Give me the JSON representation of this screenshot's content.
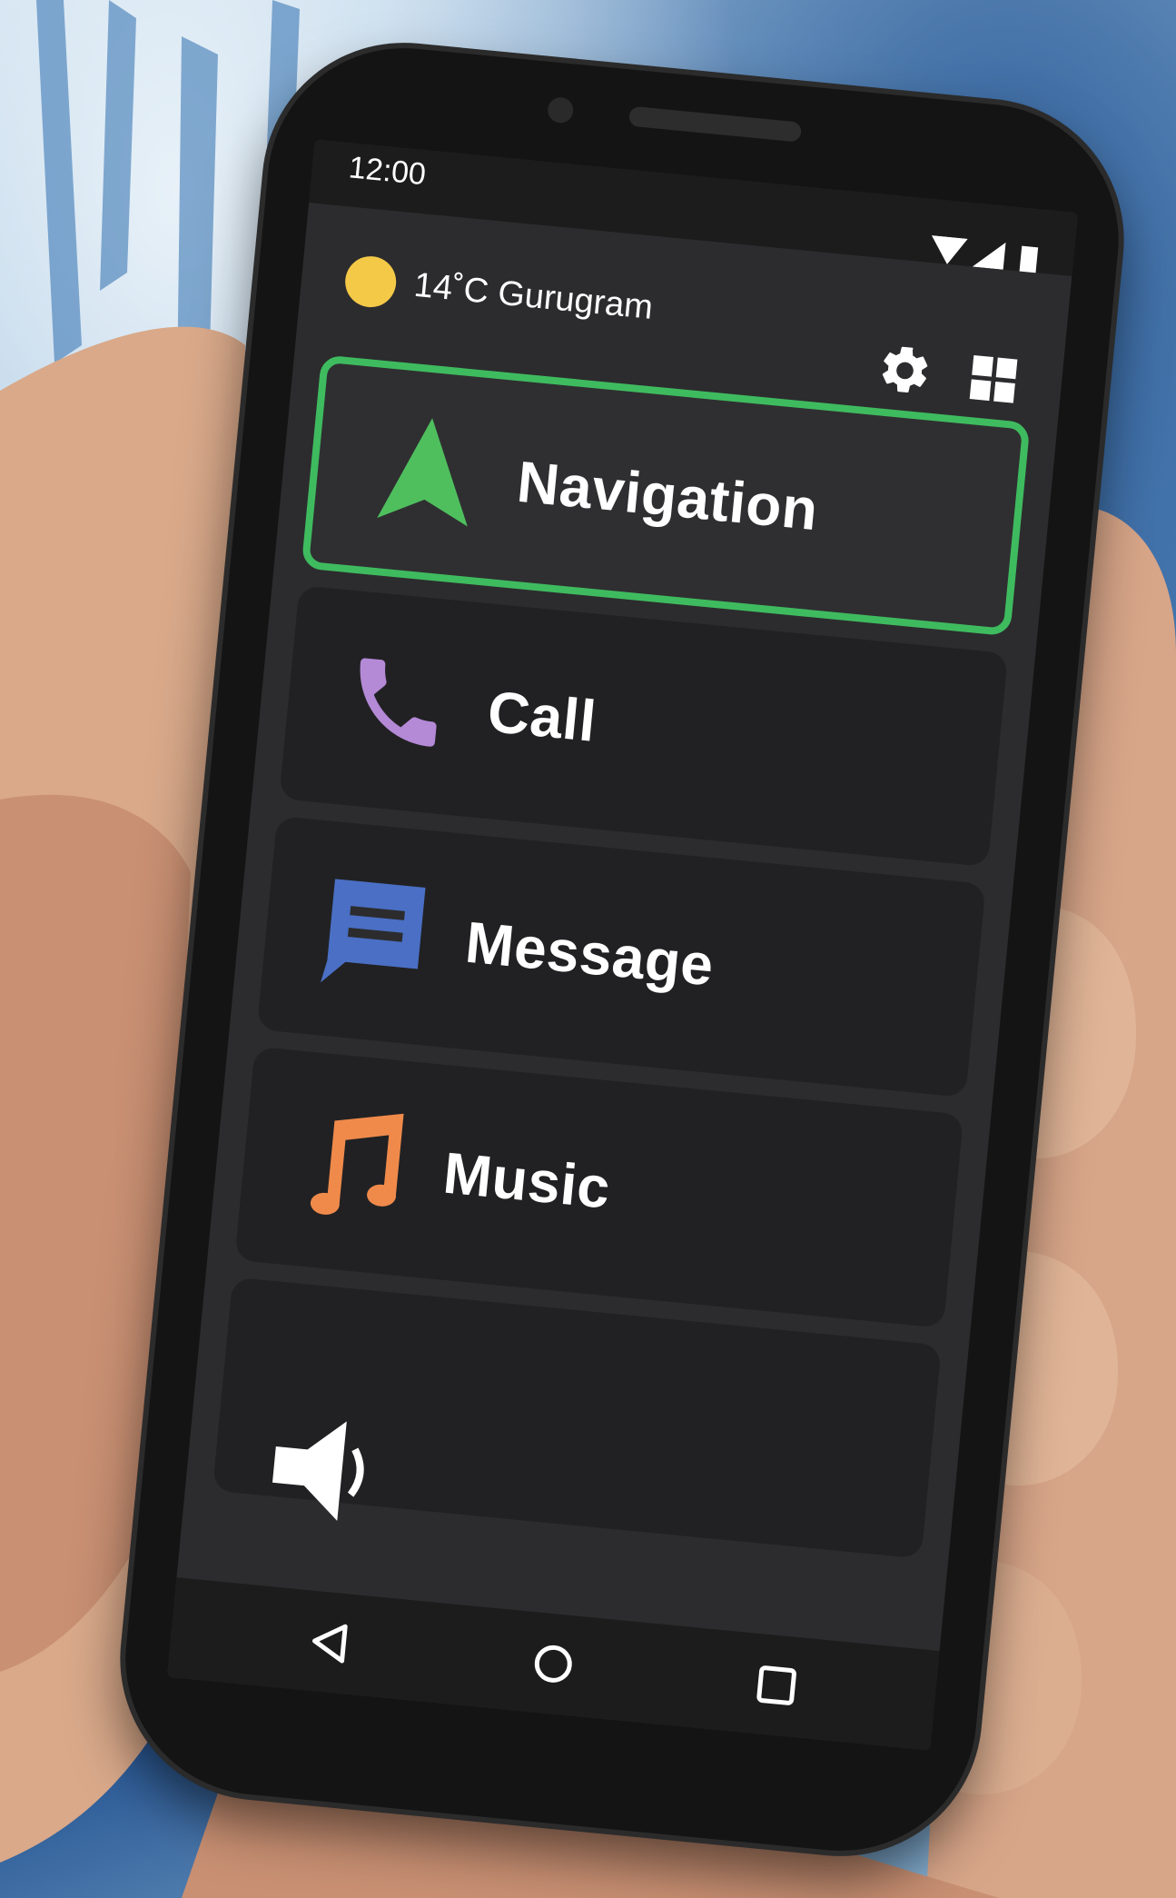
{
  "status_bar": {
    "time": "12:00"
  },
  "header": {
    "weather": "14˚C Gurugram",
    "settings_icon": "gear-icon",
    "apps_icon": "grid-icon"
  },
  "tiles": [
    {
      "label": "Navigation",
      "icon": "navigation-arrow-icon",
      "color": "#4fbf5e",
      "selected": true
    },
    {
      "label": "Call",
      "icon": "phone-icon",
      "color": "#b489d6",
      "selected": false
    },
    {
      "label": "Message",
      "icon": "message-icon",
      "color": "#4a6fc4",
      "selected": false
    },
    {
      "label": "Music",
      "icon": "music-note-icon",
      "color": "#f08a4b",
      "selected": false
    },
    {
      "label": "",
      "icon": "volume-icon",
      "color": "#ffffff",
      "selected": false
    }
  ],
  "nav_bar": {
    "back_icon": "back-triangle-icon",
    "home_icon": "home-circle-icon",
    "recents_icon": "recents-square-icon"
  },
  "colors": {
    "selection_border": "#3fbb5f",
    "tile_bg": "#212123",
    "screen_bg": "#2c2c2e",
    "sun": "#f5c948"
  }
}
